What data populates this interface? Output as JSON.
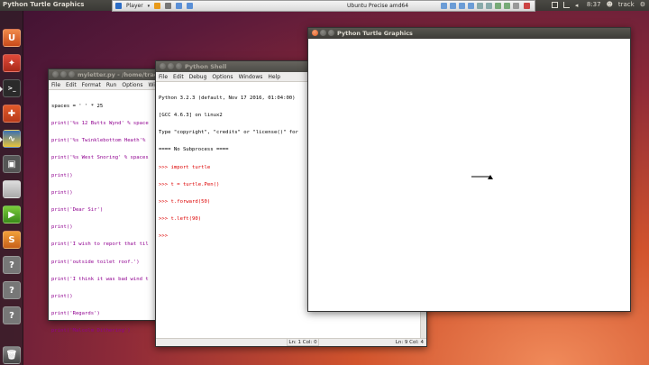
{
  "top_panel": {
    "app_title": "Python Turtle Graphics",
    "vbox": {
      "menu_label": "Player",
      "vm_title": "Ubuntu Precise amd64"
    },
    "tray": {
      "time": "8:37",
      "user": "track"
    }
  },
  "launcher": {
    "icons": [
      "dash-home",
      "ubuntu-software-center",
      "system-settings",
      "terminal",
      "workspace-switcher",
      "python",
      "trash-like-bin",
      "file-manager",
      "gedit-play",
      "text-editor",
      "unknown-app",
      "unknown-app",
      "unknown-app",
      "trash"
    ]
  },
  "editor": {
    "title": "myletter.py - /home/track",
    "menu": [
      "File",
      "Edit",
      "Format",
      "Run",
      "Options",
      "Windo"
    ],
    "lines": [
      "spaces = ' ' * 25",
      "print('%s 12 Butts Wynd' % space",
      "print('%s Twinklebottom Heath'%",
      "print('%s West Snoring' % spaces",
      "print()",
      "print()",
      "print('Dear Sir')",
      "print()",
      "print('I wish to report that til",
      "print('outside toilet roof.')",
      "print('I think it was bad wind t",
      "print()",
      "print('Regards')",
      "print('Malcolm Dithering')"
    ],
    "status": "Ln: 1 Col: 0"
  },
  "shell": {
    "title": "Python Shell",
    "menu": [
      "File",
      "Edit",
      "Debug",
      "Options",
      "Windows",
      "Help"
    ],
    "lines": [
      "Python 3.2.3 (default, Nov 17 2016, 01:04:00)",
      "[GCC 4.6.3] on linux2",
      "Type \"copyright\", \"credits\" or \"license()\" for",
      "==== No Subprocess ====",
      ">>> import turtle",
      ">>> t = turtle.Pen()",
      ">>> t.forward(50)",
      ">>> t.left(90)",
      ">>> "
    ],
    "status": "Ln: 9 Col: 4"
  },
  "turtle": {
    "title": "Python Turtle Graphics",
    "forward_distance": 50,
    "heading_degrees": 90
  }
}
